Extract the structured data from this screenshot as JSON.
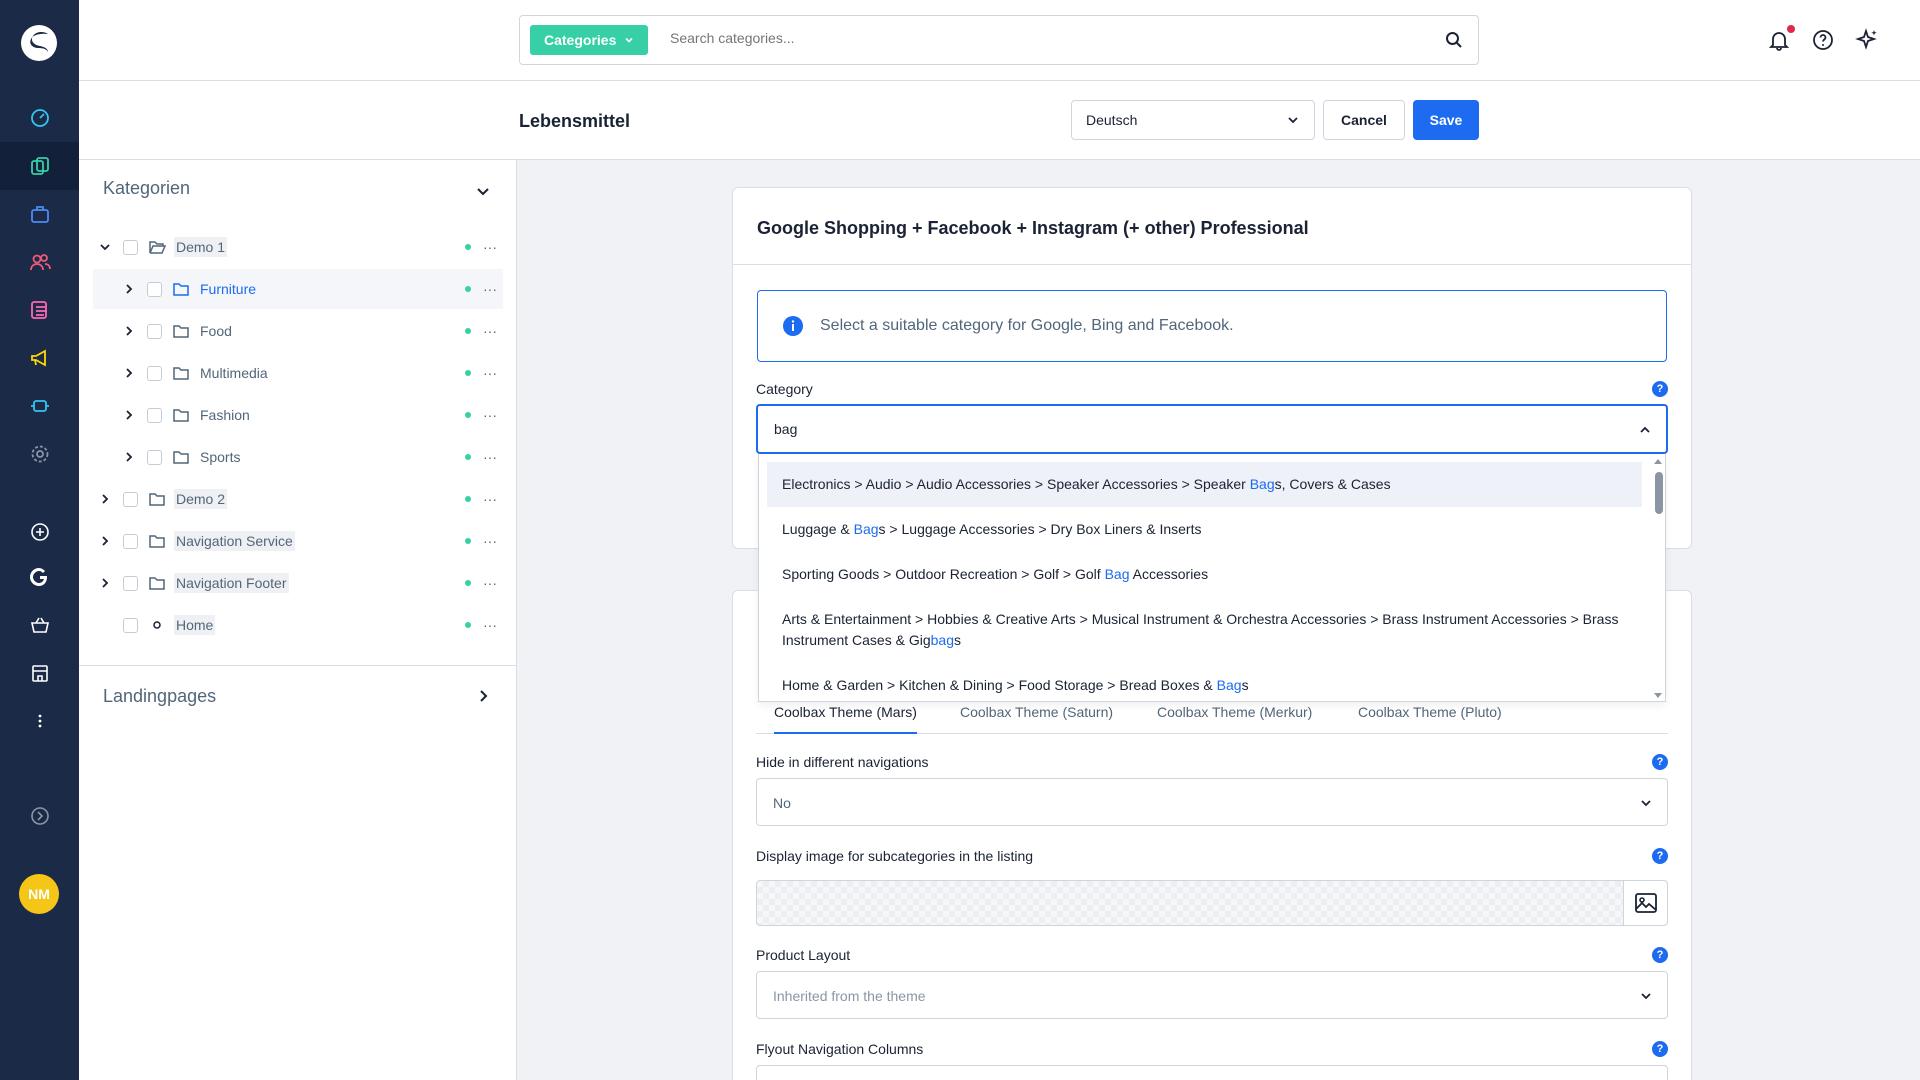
{
  "colors": {
    "nav_bg": "#1b2a47",
    "accent": "#1d6bf0",
    "category_badge": "#37d0a6",
    "status_active": "#37d0a6",
    "avatar": "#f5c518",
    "notif_dot": "#de294c"
  },
  "nav": {
    "logo": "shopware-logo-icon",
    "items": [
      "dashboard-icon",
      "catalogues-icon",
      "orders-icon",
      "customers-icon",
      "content-icon",
      "marketing-icon",
      "extensions-icon",
      "settings-icon",
      "add-icon",
      "google-icon",
      "basket-icon",
      "store-icon",
      "more-icon",
      "expand-icon"
    ],
    "avatar_initials": "NM"
  },
  "topbar": {
    "search_type": "Categories",
    "search_placeholder": "Search categories...",
    "icons": [
      "bell-icon",
      "help-icon",
      "sparkle-icon"
    ]
  },
  "actionbar": {
    "title": "Lebensmittel",
    "language": "Deutsch",
    "cancel_label": "Cancel",
    "save_label": "Save"
  },
  "tree": {
    "header": "Kategorien",
    "items": [
      {
        "label": "Demo 1",
        "level": 0,
        "expanded": true,
        "open_folder": true
      },
      {
        "label": "Furniture",
        "level": 1,
        "active": true
      },
      {
        "label": "Food",
        "level": 1
      },
      {
        "label": "Multimedia",
        "level": 1
      },
      {
        "label": "Fashion",
        "level": 1
      },
      {
        "label": "Sports",
        "level": 1
      },
      {
        "label": "Demo 2",
        "level": 0
      },
      {
        "label": "Navigation Service",
        "level": 0
      },
      {
        "label": "Navigation Footer",
        "level": 0
      },
      {
        "label": "Home",
        "level": 0,
        "leaf": true
      }
    ],
    "more_label": "···",
    "landingpages_header": "Landingpages"
  },
  "card": {
    "title": "Google Shopping + Facebook + Instagram (+ other) Professional",
    "info_text": "Select a suitable category for Google, Bing and Facebook.",
    "category_label": "Category",
    "category_value": "bag",
    "help_glyph": "?",
    "dropdown_options": [
      {
        "before": "Electronics > Audio > Audio Accessories > Speaker Accessories > Speaker ",
        "match": "Bag",
        "after": "s, Covers & Cases"
      },
      {
        "before": "Luggage & ",
        "match": "Bag",
        "after": "s > Luggage Accessories > Dry Box Liners & Inserts"
      },
      {
        "before": "Sporting Goods > Outdoor Recreation > Golf > Golf ",
        "match": "Bag",
        "after": " Accessories"
      },
      {
        "before": "Arts & Entertainment > Hobbies & Creative Arts > Musical Instrument & Orchestra Accessories > Brass Instrument Accessories > Brass Instrument Cases & Gig",
        "match": "bag",
        "after": "s"
      },
      {
        "before": "Home & Garden > Kitchen & Dining > Food Storage > Bread Boxes & ",
        "match": "Bag",
        "after": "s"
      }
    ]
  },
  "theme": {
    "tabs": [
      "Coolbax Theme (Mars)",
      "Coolbax Theme (Saturn)",
      "Coolbax Theme (Merkur)",
      "Coolbax Theme (Pluto)"
    ],
    "hide_label": "Hide in different navigations",
    "hide_value": "No",
    "image_label": "Display image for subcategories in the listing",
    "layout_label": "Product Layout",
    "layout_value": "Inherited from the theme",
    "flyout_label": "Flyout Navigation Columns"
  }
}
